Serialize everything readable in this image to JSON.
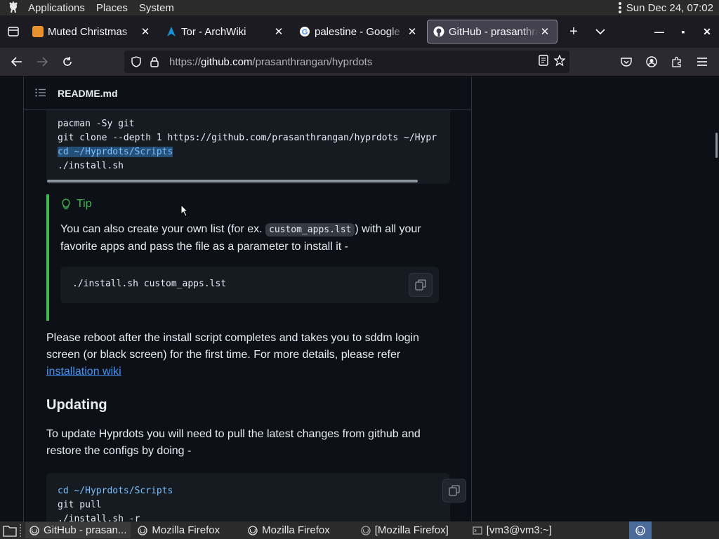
{
  "top_panel": {
    "menus": [
      "Applications",
      "Places",
      "System"
    ],
    "clock": "Sun Dec 24, 07:02"
  },
  "tabs": [
    {
      "label": "Muted Christmas",
      "favicon_color": "#e8922e",
      "active": false
    },
    {
      "label": "Tor - ArchWiki",
      "favicon_color": "#1793d1",
      "active": false
    },
    {
      "label": "palestine - Google",
      "favicon_color": "#4285f4",
      "active": false
    },
    {
      "label": "GitHub - prasanthrangan",
      "favicon_color": "#ffffff",
      "active": true
    }
  ],
  "urlbar": {
    "scheme": "https://",
    "host": "github.com",
    "path": "/prasanthrangan/hyprdots"
  },
  "readme": {
    "title": "README.md",
    "install_code": [
      "pacman -Sy git",
      "git clone --depth 1 https://github.com/prasanthrangan/hyprdots ~/Hypr",
      "cd ~/Hyprdots/Scripts",
      "./install.sh"
    ],
    "tip": {
      "title": "Tip",
      "text_before": "You can also create your own list (for ex. ",
      "inline_code": "custom_apps.lst",
      "text_after": ") with all your favorite apps and pass the file as a parameter to install it -",
      "code": "./install.sh custom_apps.lst"
    },
    "reboot_text": "Please reboot after the install script completes and takes you to sddm login screen (or black screen) for the first time. For more details, please refer ",
    "reboot_link": "installation wiki",
    "updating_heading": "Updating",
    "update_text": "To update Hyprdots you will need to pull the latest changes from github and restore the configs by doing -",
    "update_code": [
      "cd ~/Hyprdots/Scripts",
      "git pull",
      "./install.sh -r"
    ]
  },
  "taskbar": {
    "tasks": [
      {
        "label": "GitHub - prasan...",
        "active": true
      },
      {
        "label": "Mozilla Firefox",
        "active": false
      },
      {
        "label": "Mozilla Firefox",
        "active": false
      },
      {
        "label": "[Mozilla Firefox]",
        "active": false
      },
      {
        "label": "[vm3@vm3:~]",
        "active": false
      }
    ]
  },
  "colors": {
    "accent_link": "#4493f8",
    "tip_green": "#3fb950",
    "page_bg": "#0d1117"
  }
}
